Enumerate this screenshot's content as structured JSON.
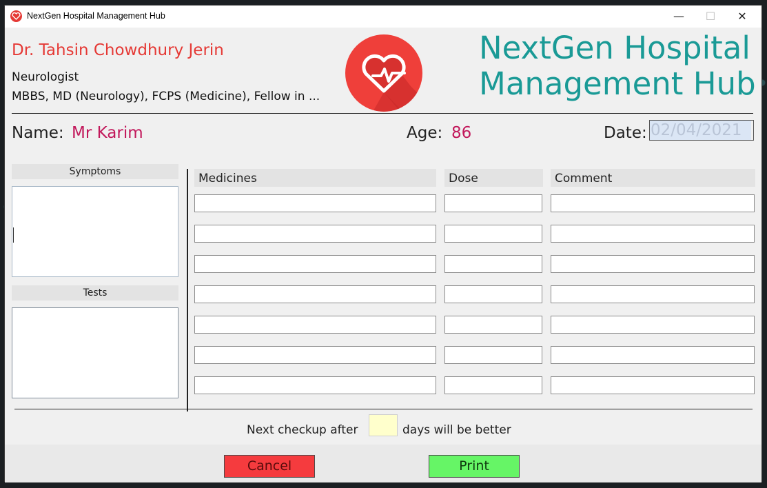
{
  "window": {
    "title": "NextGen Hospital Management Hub",
    "controls": {
      "minimize": "—",
      "maximize": "☐",
      "close": "✕"
    }
  },
  "doctor": {
    "name": "Dr. Tahsin Chowdhury Jerin",
    "specialty": "Neurologist",
    "degrees": "MBBS, MD (Neurology), FCPS (Medicine), Fellow in ..."
  },
  "branding": {
    "logo_icon": "heart-pulse-icon",
    "title_line1": "NextGen Hospital",
    "title_line2": "Management Hub",
    "accent_color": "#1a9a96"
  },
  "patient": {
    "name_label": "Name:",
    "name_value": "Mr Karim",
    "age_label": "Age:",
    "age_value": "86",
    "date_label": "Date:",
    "date_value": "02/04/2021"
  },
  "sections": {
    "symptoms_label": "Symptoms",
    "tests_label": "Tests"
  },
  "prescription": {
    "columns": [
      "Medicines",
      "Dose",
      "Comment"
    ],
    "rows": [
      {
        "medicine": "",
        "dose": "",
        "comment": ""
      },
      {
        "medicine": "",
        "dose": "",
        "comment": ""
      },
      {
        "medicine": "",
        "dose": "",
        "comment": ""
      },
      {
        "medicine": "",
        "dose": "",
        "comment": ""
      },
      {
        "medicine": "",
        "dose": "",
        "comment": ""
      },
      {
        "medicine": "",
        "dose": "",
        "comment": ""
      },
      {
        "medicine": "",
        "dose": "",
        "comment": ""
      }
    ]
  },
  "next_checkup": {
    "prefix": "Next checkup after",
    "suffix": "days will be better",
    "days_value": ""
  },
  "actions": {
    "cancel_label": "Cancel",
    "print_label": "Print",
    "cancel_color": "#f53b3e",
    "print_color": "#66f566"
  }
}
